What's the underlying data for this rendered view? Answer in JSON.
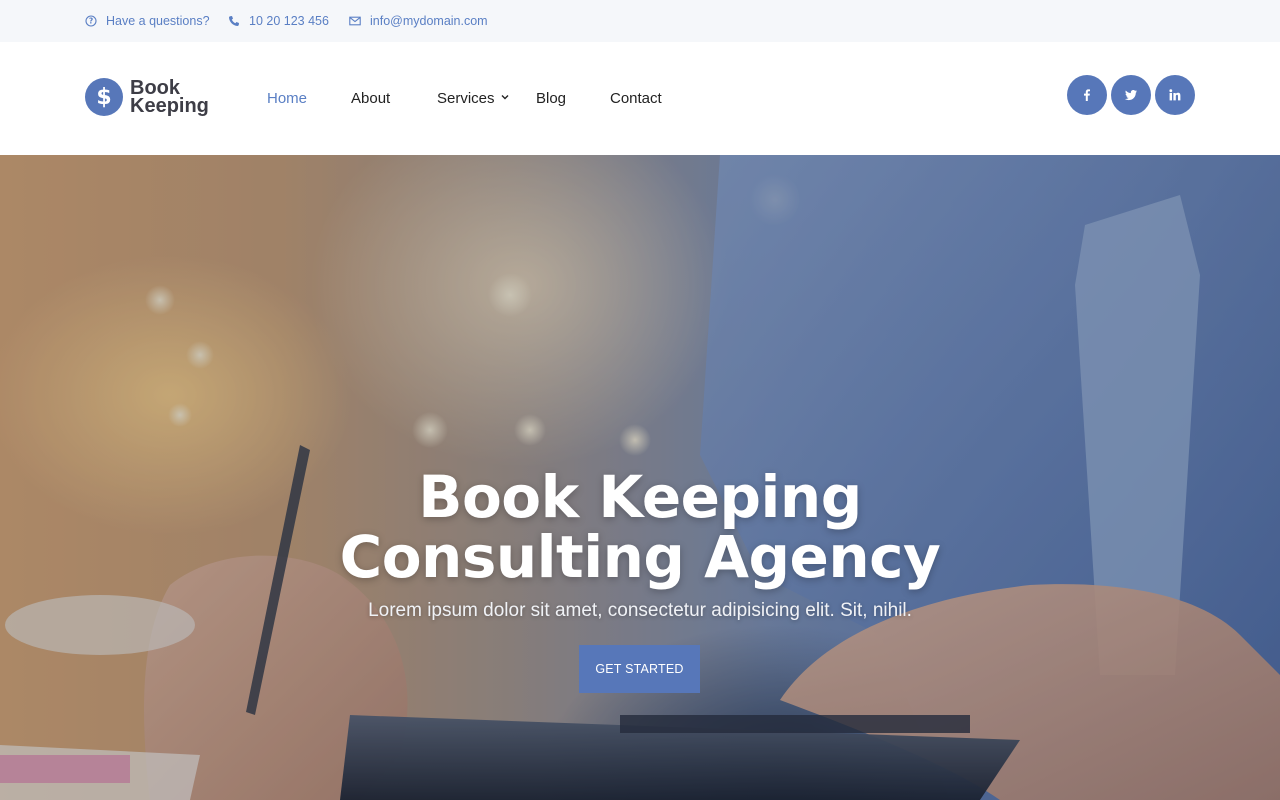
{
  "topbar": {
    "questions": "Have a questions?",
    "phone": "10 20 123 456",
    "email": "info@mydomain.com",
    "icons": {
      "questions": "question-circle-icon",
      "phone": "phone-icon",
      "email": "envelope-icon"
    }
  },
  "logo": {
    "symbol": "$",
    "line1": "Book",
    "line2": "Keeping"
  },
  "nav": {
    "items": [
      {
        "label": "Home",
        "active": true
      },
      {
        "label": "About",
        "active": false
      },
      {
        "label": "Services",
        "active": false,
        "has_dropdown": true
      },
      {
        "label": "Blog",
        "active": false
      },
      {
        "label": "Contact",
        "active": false
      }
    ]
  },
  "social": {
    "items": [
      {
        "icon": "facebook-icon"
      },
      {
        "icon": "twitter-icon"
      },
      {
        "icon": "linkedin-icon"
      }
    ]
  },
  "hero": {
    "title_line1": "Book Keeping",
    "title_line2": "Consulting Agency",
    "subtitle": "Lorem ipsum dolor sit amet, consectetur adipisicing elit. Sit, nihil.",
    "cta": "GET STARTED"
  },
  "colors": {
    "accent": "#5777b9",
    "link": "#5a7fc4",
    "topbar_bg": "#f5f7fa",
    "text_dark": "#222222"
  }
}
